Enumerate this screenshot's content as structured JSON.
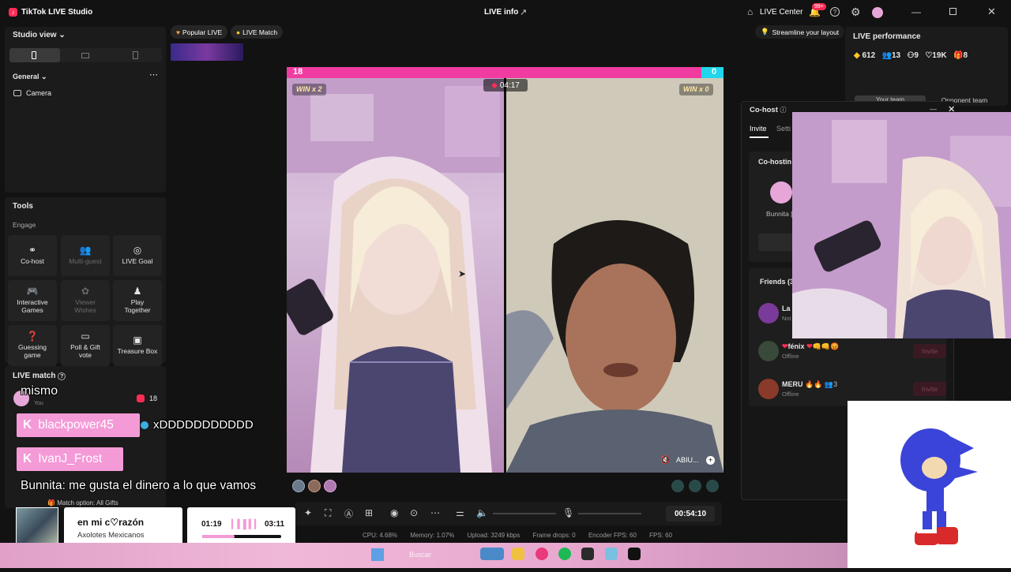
{
  "app": {
    "title": "TikTok LIVE Studio",
    "center_title": "LIVE info",
    "live_center": "LIVE Center",
    "notif_badge": "99+"
  },
  "left": {
    "studio_view": "Studio view",
    "scene_group": "General",
    "source": "Camera",
    "tools_title": "Tools",
    "engage_label": "Engage",
    "tools": [
      {
        "label": "Co-host",
        "icon": "link-icon",
        "enabled": true
      },
      {
        "label": "Multi-guest",
        "icon": "people-icon",
        "enabled": false
      },
      {
        "label": "LIVE Goal",
        "icon": "target-icon",
        "enabled": true
      },
      {
        "label": "Interactive\nGames",
        "icon": "gamepad-icon",
        "enabled": true
      },
      {
        "label": "Viewer\nWishes",
        "icon": "wish-icon",
        "enabled": false
      },
      {
        "label": "Play\nTogether",
        "icon": "joystick-icon",
        "enabled": true
      },
      {
        "label": "Guessing\ngame",
        "icon": "question-icon",
        "enabled": true
      },
      {
        "label": "Poll & Gift\nvote",
        "icon": "poll-icon",
        "enabled": true
      },
      {
        "label": "Treasure Box",
        "icon": "chest-icon",
        "enabled": true
      }
    ],
    "live_match": "LIVE match",
    "match_user_sub": "You",
    "match_score": "18",
    "match_option": "Match option: All Gifts"
  },
  "top_chips": {
    "popular": "Popular LIVE",
    "match": "LIVE Match",
    "streamline": "Streamline your layout"
  },
  "match": {
    "left_score": "18",
    "right_score": "0",
    "timer": "04:17",
    "left_win": "WIN x 2",
    "right_win": "WIN x 0",
    "left_share": 0.95,
    "opponent_tag": "ABIU..."
  },
  "toolbar": {
    "duration": "00:54:10"
  },
  "status": {
    "cpu": "CPU: 4.68%",
    "memory": "Memory: 1.07%",
    "upload": "Upload: 3249 kbps",
    "frame_drops": "Frame drops: 0",
    "encoder_fps": "Encoder FPS: 60",
    "fps": "FPS: 60"
  },
  "performance": {
    "title": "LIVE performance",
    "diamonds": "612",
    "viewers": "13",
    "new_followers": "9",
    "likes": "19K",
    "gifters": "8",
    "tab_your": "Your team",
    "tab_opp": "Opponent team"
  },
  "cohost": {
    "title": "Co-host",
    "tab_invite": "Invite",
    "tab_settings": "Setti",
    "cohosting": "Co-hostin",
    "host_name": "Bunnita [",
    "friends_title": "Friends (3",
    "friends": [
      {
        "name": "La",
        "status": "Not",
        "invite": ""
      },
      {
        "name": "fénix",
        "status": "Offline",
        "invite": "Invite"
      },
      {
        "name": "MERU",
        "status": "Offline",
        "count": "3",
        "invite": "Invite"
      }
    ]
  },
  "overlay_chat": {
    "mismo": "mismo",
    "name1": "blackpower45",
    "msg1": "xDDDDDDDDDDD",
    "name2": "IvanJ_Frost",
    "bunnita_line": "Bunnita: me gusta el dinero a lo que vamos"
  },
  "music": {
    "title": "en mi c♡razón",
    "artist": "Axolotes Mexicanos",
    "elapsed": "01:19",
    "total": "03:11",
    "progress": 0.41
  },
  "taskbar": {
    "search": "Buscar"
  },
  "colors": {
    "accent": "#fe2c55",
    "pink": "#f03ca0",
    "cyan": "#20d5ec"
  }
}
